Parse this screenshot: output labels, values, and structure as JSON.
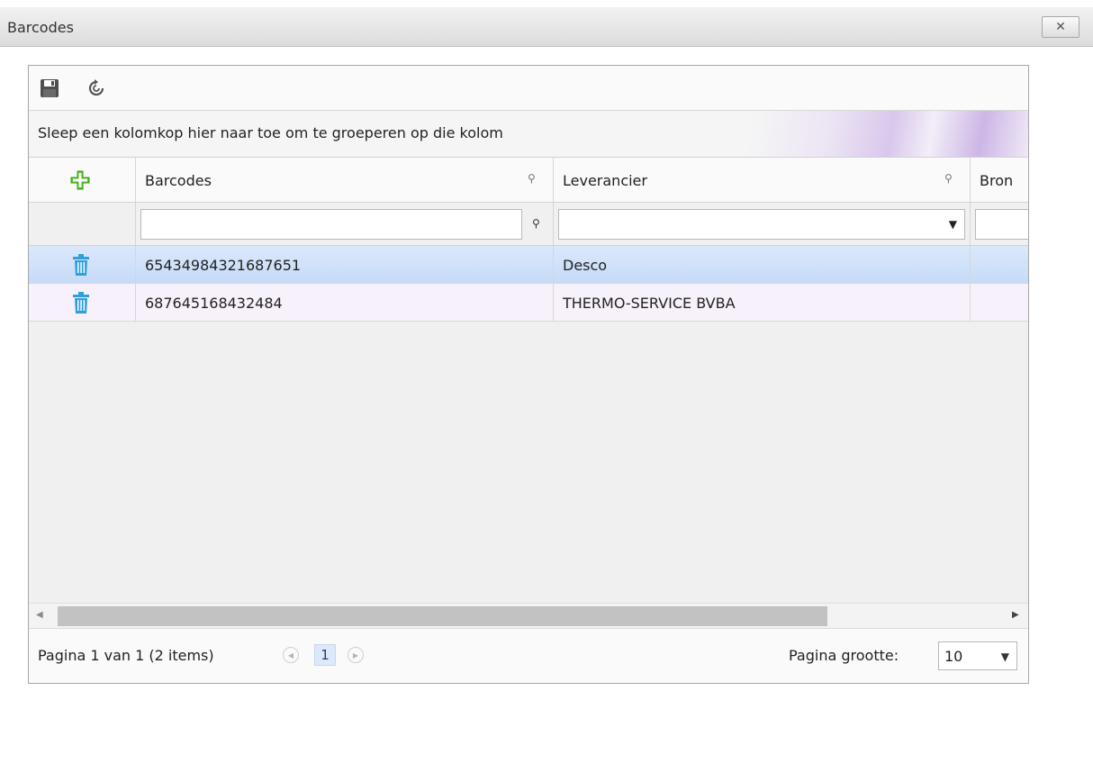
{
  "window": {
    "title": "Barcodes",
    "close_glyph": "✕"
  },
  "toolbar": {
    "icons": [
      "save-icon",
      "refresh-icon"
    ]
  },
  "group_panel": {
    "text": "Sleep een kolomkop hier naar toe om te groeperen op die kolom"
  },
  "columns": [
    {
      "label": "Barcodes"
    },
    {
      "label": "Leverancier"
    },
    {
      "label": "Bron"
    }
  ],
  "rows": [
    {
      "barcode": "65434984321687651",
      "leverancier": "Desco",
      "selected": true
    },
    {
      "barcode": "687645168432484",
      "leverancier": "THERMO-SERVICE BVBA",
      "selected": false
    }
  ],
  "pager": {
    "info": "Pagina 1 van 1 (2 items)",
    "current_page": "1",
    "page_size_label": "Pagina grootte:",
    "page_size": "10"
  },
  "colors": {
    "selected_row": "#c6dbf7",
    "alt_row": "#f6f1fb",
    "add_icon": "#58c22a",
    "trash_icon": "#2f9fe0"
  }
}
